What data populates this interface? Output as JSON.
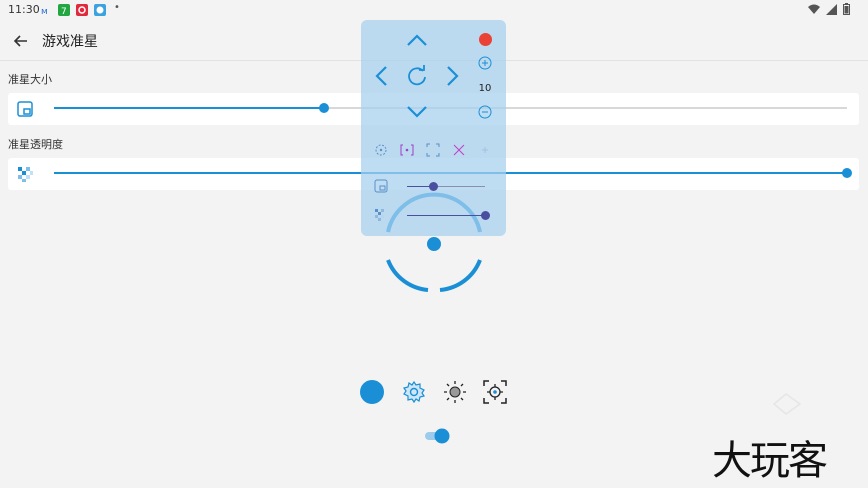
{
  "status_bar": {
    "time": "11:30",
    "notification_icons": [
      "app-icon-1",
      "app-icon-2",
      "app-icon-3",
      "app-icon-4"
    ],
    "system_icons": [
      "wifi-icon",
      "signal-icon",
      "battery-icon"
    ]
  },
  "app_bar": {
    "title": "游戏准星",
    "back_icon": "arrow-left-icon"
  },
  "settings": {
    "size_label": "准星大小",
    "size_value": 0.34,
    "opacity_label": "准星透明度",
    "opacity_value": 1.0
  },
  "control_panel": {
    "step_value": "10",
    "icons": [
      "up-icon",
      "left-icon",
      "reset-icon",
      "right-icon",
      "down-icon",
      "record-icon",
      "zoom-in-icon",
      "zoom-out-icon"
    ],
    "mode_icons": [
      "target-circle-icon",
      "bracket-dot-icon",
      "corners-icon",
      "x-arrows-icon",
      "plus-icon"
    ],
    "mini_size_value": 0.33,
    "mini_opacity_value": 1.0
  },
  "bottom_bar": {
    "icons": [
      "color-dot-icon",
      "gear-icon",
      "brightness-icon",
      "crosshair-icon"
    ],
    "toggle_on": true
  },
  "watermark": "大玩客",
  "colors": {
    "accent": "#1a8fd6",
    "panel": "#a5d0ee",
    "record": "#ea4335",
    "panel_slider": "#4b4fa0"
  }
}
